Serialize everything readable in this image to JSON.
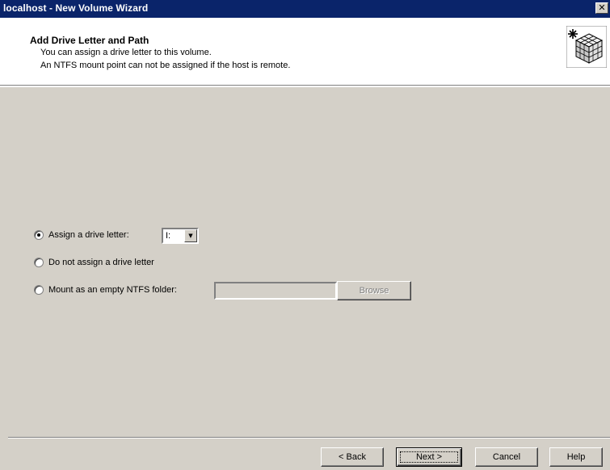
{
  "window": {
    "title": "localhost - New Volume Wizard",
    "close_glyph": "✕"
  },
  "header": {
    "title": "Add Drive Letter and Path",
    "line1": "You can assign a drive letter to this volume.",
    "line2": "An NTFS mount point can not be assigned if the host is remote.",
    "logo_icon": "volume-wizard-cube-icon"
  },
  "options": {
    "assign_letter_label": "Assign a drive letter:",
    "drive_letter_value": "I:",
    "no_letter_label": "Do not assign a drive letter",
    "mount_label": "Mount as an empty NTFS folder:",
    "mount_path_value": "",
    "browse_label": "Browse",
    "selected": "assign_letter"
  },
  "buttons": {
    "back": "< Back",
    "next": "Next >",
    "cancel": "Cancel",
    "help": "Help"
  },
  "colors": {
    "titlebar": "#0a246a",
    "dialog": "#d4d0c8",
    "header_bg": "#ffffff"
  }
}
